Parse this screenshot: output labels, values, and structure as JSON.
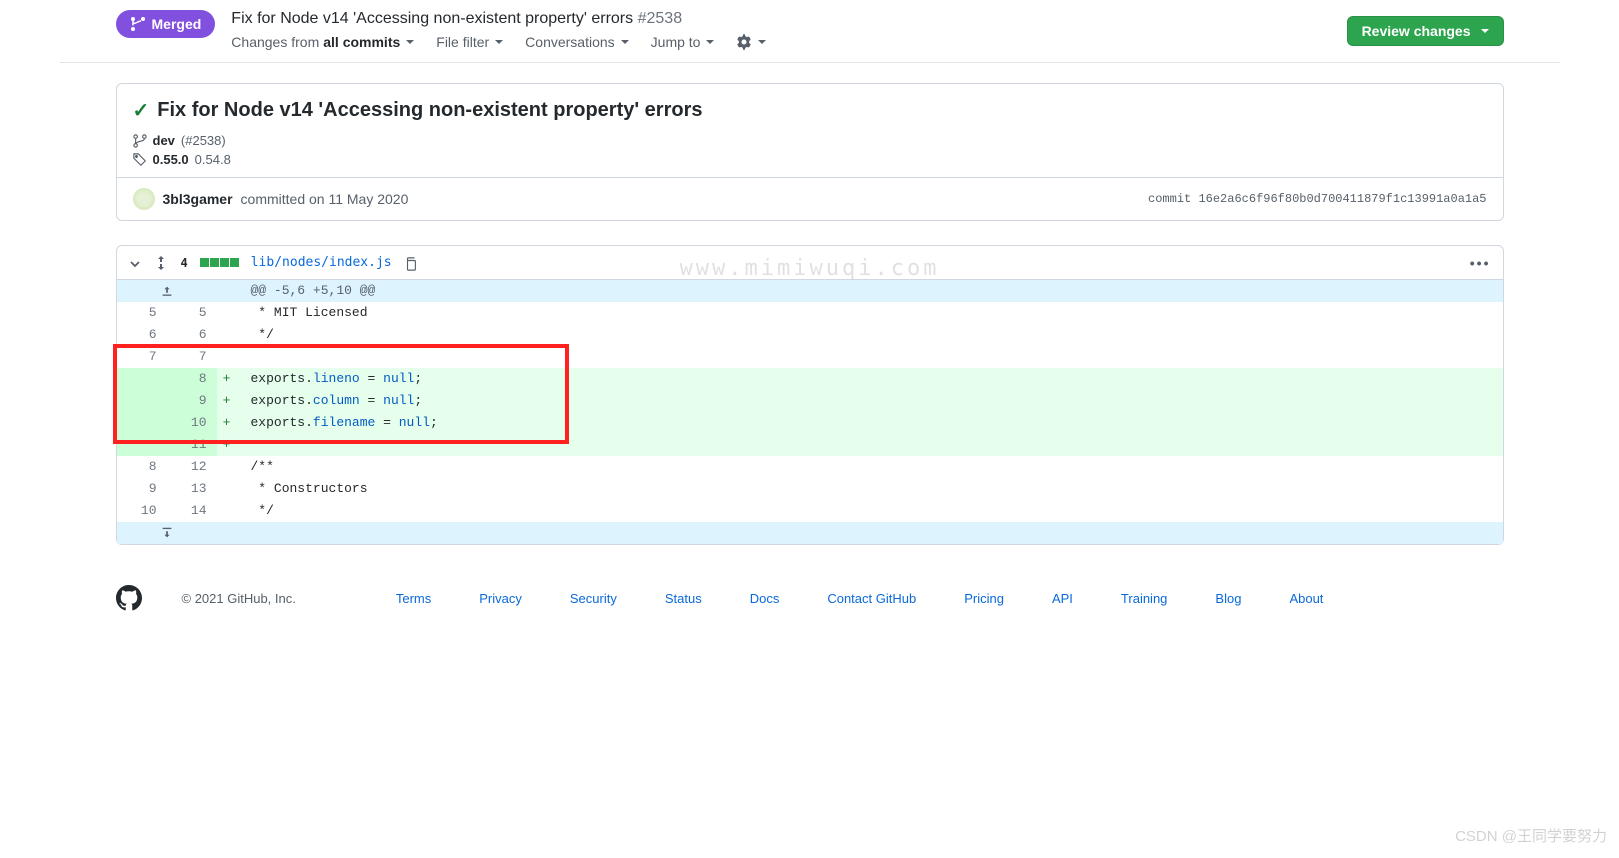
{
  "header": {
    "mergedLabel": "Merged",
    "title": "Fix for Node v14 'Accessing non-existent property' errors",
    "prNumber": "#2538",
    "filters": {
      "changesFrom": "Changes from",
      "changesFromValue": "all commits",
      "fileFilter": "File filter",
      "conversations": "Conversations",
      "jumpTo": "Jump to"
    },
    "reviewButton": "Review changes"
  },
  "commit": {
    "title": "Fix for Node v14 'Accessing non-existent property' errors",
    "branch": "dev",
    "branchRef": "(#2538)",
    "tagBold": "0.55.0",
    "tagOther": "0.54.8",
    "author": "3bl3gamer",
    "committedText": "committed on 11 May 2020",
    "hashLabel": "commit",
    "hash": "16e2a6c6f96f80b0d700411879f1c13991a0a1a5"
  },
  "diff": {
    "changeCount": "4",
    "filePath": "lib/nodes/index.js",
    "hunkHeader": "@@ -5,6 +5,10 @@",
    "rows": [
      {
        "type": "ctx",
        "old": "5",
        "new": "5",
        "marker": " ",
        "code": " * MIT Licensed"
      },
      {
        "type": "ctx",
        "old": "6",
        "new": "6",
        "marker": " ",
        "code": " */"
      },
      {
        "type": "ctx",
        "old": "7",
        "new": "7",
        "marker": " ",
        "code": ""
      },
      {
        "type": "add",
        "old": "",
        "new": "8",
        "marker": "+",
        "codeParts": [
          [
            "",
            "exports."
          ],
          [
            "prop",
            "lineno"
          ],
          [
            "",
            " = "
          ],
          [
            "kw",
            "null"
          ],
          [
            "",
            ";"
          ]
        ]
      },
      {
        "type": "add",
        "old": "",
        "new": "9",
        "marker": "+",
        "codeParts": [
          [
            "",
            "exports."
          ],
          [
            "prop",
            "column"
          ],
          [
            "",
            " = "
          ],
          [
            "kw",
            "null"
          ],
          [
            "",
            ";"
          ]
        ]
      },
      {
        "type": "add",
        "old": "",
        "new": "10",
        "marker": "+",
        "codeParts": [
          [
            "",
            "exports."
          ],
          [
            "prop",
            "filename"
          ],
          [
            "",
            " = "
          ],
          [
            "kw",
            "null"
          ],
          [
            "",
            ";"
          ]
        ]
      },
      {
        "type": "add",
        "old": "",
        "new": "11",
        "marker": "+",
        "code": ""
      },
      {
        "type": "ctx",
        "old": "8",
        "new": "12",
        "marker": " ",
        "code": "/**"
      },
      {
        "type": "ctx",
        "old": "9",
        "new": "13",
        "marker": " ",
        "code": " * Constructors"
      },
      {
        "type": "ctx",
        "old": "10",
        "new": "14",
        "marker": " ",
        "code": " */"
      }
    ]
  },
  "watermark": "www.mimiwuqi.com",
  "footer": {
    "copyright": "© 2021 GitHub, Inc.",
    "links": [
      "Terms",
      "Privacy",
      "Security",
      "Status",
      "Docs",
      "Contact GitHub",
      "Pricing",
      "API",
      "Training",
      "Blog",
      "About"
    ]
  },
  "csdn": "CSDN @王同学要努力"
}
